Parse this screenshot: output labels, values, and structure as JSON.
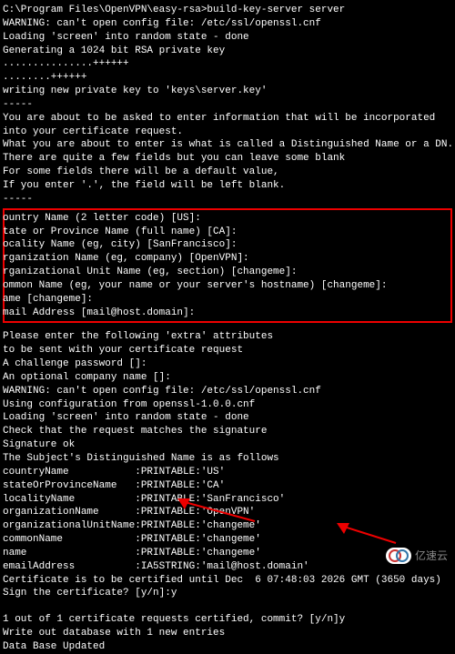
{
  "head": {
    "l0": "C:\\Program Files\\OpenVPN\\easy-rsa>build-key-server server",
    "l1": "WARNING: can't open config file: /etc/ssl/openssl.cnf",
    "l2": "Loading 'screen' into random state - done",
    "l3": "Generating a 1024 bit RSA private key",
    "l4": "...............++++++",
    "l5": "........++++++",
    "l6": "writing new private key to 'keys\\server.key'",
    "l7": "-----",
    "l8": "You are about to be asked to enter information that will be incorporated",
    "l9": "into your certificate request.",
    "l10": "What you are about to enter is what is called a Distinguished Name or a DN.",
    "l11": "There are quite a few fields but you can leave some blank",
    "l12": "For some fields there will be a default value,",
    "l13": "If you enter '.', the field will be left blank.",
    "l14": "-----"
  },
  "box": {
    "l0": "ountry Name (2 letter code) [US]:",
    "l1": "tate or Province Name (full name) [CA]:",
    "l2": "ocality Name (eg, city) [SanFrancisco]:",
    "l3": "rganization Name (eg, company) [OpenVPN]:",
    "l4": "rganizational Unit Name (eg, section) [changeme]:",
    "l5": "ommon Name (eg, your name or your server's hostname) [changeme]:",
    "l6": "ame [changeme]:",
    "l7": "mail Address [mail@host.domain]:"
  },
  "mid": {
    "l0": "Please enter the following 'extra' attributes",
    "l1": "to be sent with your certificate request",
    "l2": "A challenge password []:",
    "l3": "An optional company name []:",
    "l4": "WARNING: can't open config file: /etc/ssl/openssl.cnf",
    "l5": "Using configuration from openssl-1.0.0.cnf",
    "l6": "Loading 'screen' into random state - done",
    "l7": "Check that the request matches the signature",
    "l8": "Signature ok",
    "l9": "The Subject's Distinguished Name is as follows",
    "l10": "countryName           :PRINTABLE:'US'",
    "l11": "stateOrProvinceName   :PRINTABLE:'CA'",
    "l12": "localityName          :PRINTABLE:'SanFrancisco'",
    "l13": "organizationName      :PRINTABLE:'OpenVPN'",
    "l14": "organizationalUnitName:PRINTABLE:'changeme'",
    "l15": "commonName            :PRINTABLE:'changeme'",
    "l16": "name                  :PRINTABLE:'changeme'",
    "l17": "emailAddress          :IA5STRING:'mail@host.domain'",
    "l18": "Certificate is to be certified until Dec  6 07:48:03 2026 GMT (3650 days)",
    "l19": "Sign the certificate? [y/n]:y"
  },
  "tail": {
    "l0": "1 out of 1 certificate requests certified, commit? [y/n]y",
    "l1": "Write out database with 1 new entries",
    "l2": "Data Base Updated"
  },
  "watermark": "亿速云"
}
